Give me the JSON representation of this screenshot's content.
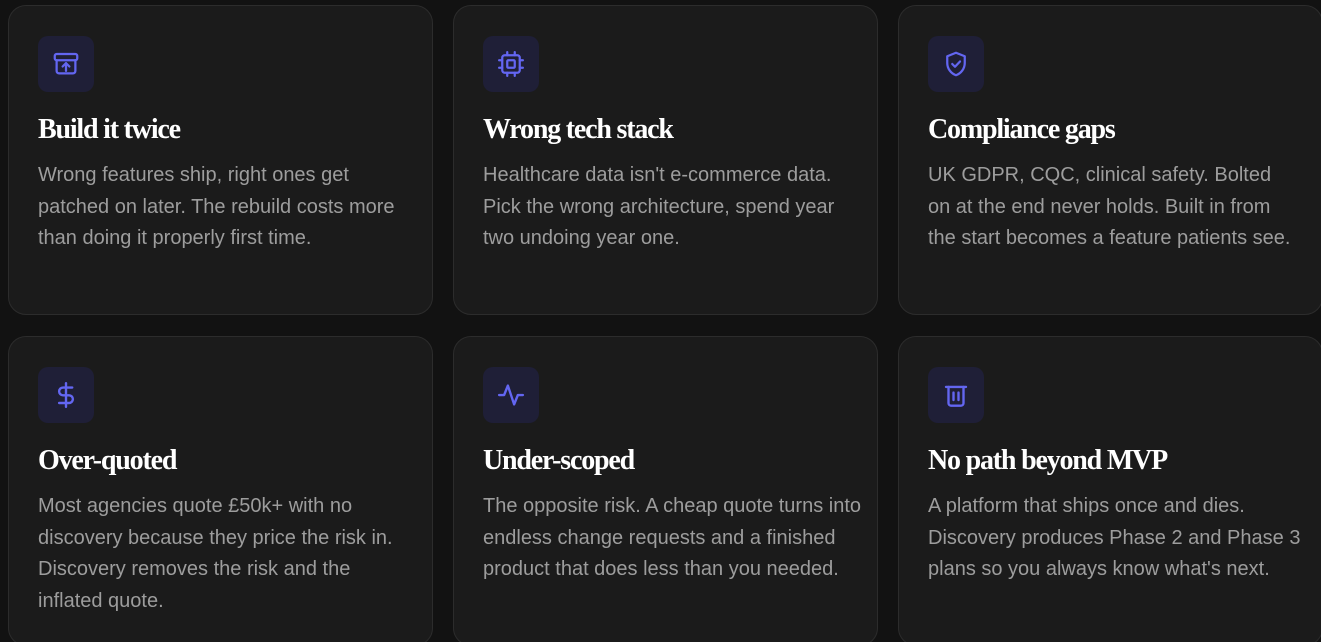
{
  "colors": {
    "background": "#121212",
    "card": "#1b1b1b",
    "card_border": "#2c2c2c",
    "icon_bg": "#1f1f37",
    "icon_stroke": "#6366f1",
    "title": "#ffffff",
    "body_text": "#9d9d9d"
  },
  "cards": [
    {
      "icon": "archive-upload-icon",
      "title": "Build it twice",
      "description": "Wrong features ship, right ones get patched on later. The rebuild costs more than doing it properly first time."
    },
    {
      "icon": "cpu-chip-icon",
      "title": "Wrong tech stack",
      "description": "Healthcare data isn't e-commerce data. Pick the wrong architecture, spend year two undoing year one."
    },
    {
      "icon": "shield-check-icon",
      "title": "Compliance gaps",
      "description": "UK GDPR, CQC, clinical safety. Bolted on at the end never holds. Built in from the start becomes a feature patients see."
    },
    {
      "icon": "dollar-sign-icon",
      "title": "Over-quoted",
      "description": "Most agencies quote £50k+ with no discovery because they price the risk in. Discovery removes the risk and the inflated quote."
    },
    {
      "icon": "activity-pulse-icon",
      "title": "Under-scoped",
      "description": "The opposite risk. A cheap quote turns into endless change requests and a finished product that does less than you needed."
    },
    {
      "icon": "trash-icon",
      "title": "No path beyond MVP",
      "description": "A platform that ships once and dies. Discovery produces Phase 2 and Phase 3 plans so you always know what's next."
    }
  ]
}
